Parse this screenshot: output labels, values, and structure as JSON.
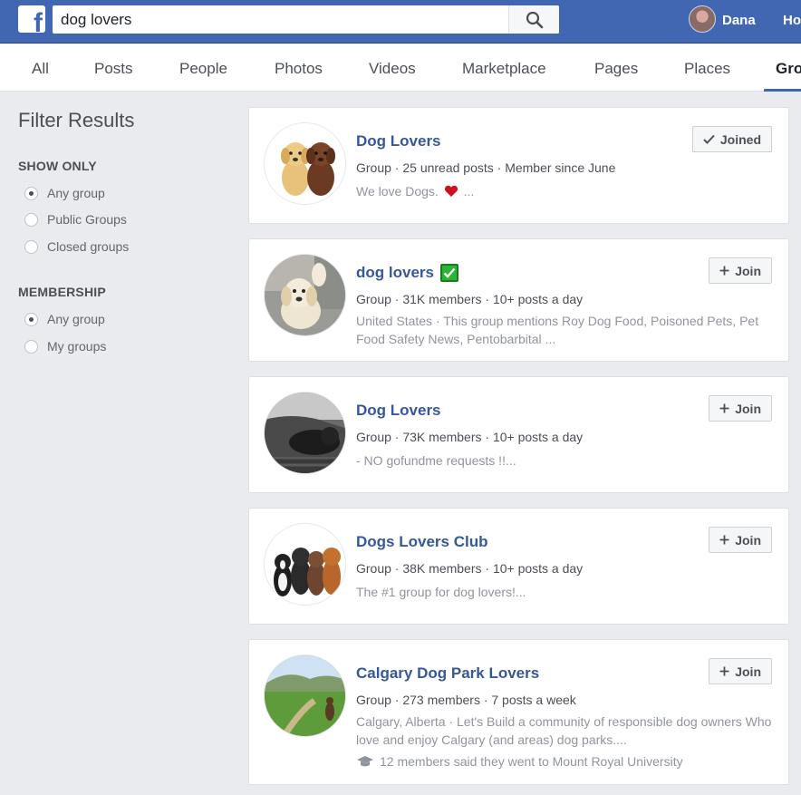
{
  "header": {
    "search_value": "dog lovers",
    "user_name": "Dana",
    "home_label": "Home",
    "icons": {
      "logo": "facebook-f-logo",
      "search": "magnifier-icon"
    }
  },
  "tabs": [
    "All",
    "Posts",
    "People",
    "Photos",
    "Videos",
    "Marketplace",
    "Pages",
    "Places",
    "Groups"
  ],
  "active_tab": "Groups",
  "sidebar": {
    "title": "Filter Results",
    "show_only": {
      "heading": "SHOW ONLY",
      "options": [
        "Any group",
        "Public Groups",
        "Closed groups"
      ],
      "selected": "Any group"
    },
    "membership": {
      "heading": "MEMBERSHIP",
      "options": [
        "Any group",
        "My groups"
      ],
      "selected": "Any group"
    }
  },
  "results": [
    {
      "name": "Dog Lovers",
      "meta": "Group · 25 unread posts · Member since June",
      "desc": "We love Dogs.",
      "desc_suffix": "...",
      "desc_emoji": "heart",
      "action": "Joined",
      "action_icon": "checkmark-icon"
    },
    {
      "name": "dog lovers",
      "verified_emoji": "white-check-mark",
      "meta": "Group · 31K members · 10+ posts a day",
      "desc": "United States · This group mentions Roy Dog Food, Poisoned Pets, Pet Food Safety News, Pentobarbital ...",
      "action": "Join",
      "action_icon": "plus-icon"
    },
    {
      "name": "Dog Lovers",
      "meta": "Group · 73K members · 10+ posts a day",
      "desc": "- NO gofundme requests !!...",
      "action": "Join",
      "action_icon": "plus-icon"
    },
    {
      "name": "Dogs Lovers Club",
      "meta": "Group · 38K members · 10+ posts a day",
      "desc": "The #1 group for dog lovers!...",
      "action": "Join",
      "action_icon": "plus-icon"
    },
    {
      "name": "Calgary Dog Park Lovers",
      "meta": "Group · 273 members · 7 posts a week",
      "desc": "Calgary, Alberta · Let's Build a community of responsible dog owners Who love and enjoy Calgary (and areas) dog parks....",
      "note": "12 members said they went to Mount Royal University",
      "note_icon": "graduation-cap-icon",
      "action": "Join",
      "action_icon": "plus-icon"
    }
  ],
  "colors": {
    "brand_blue": "#4267b2",
    "link_blue": "#365899",
    "page_bg": "#e9ebee"
  }
}
